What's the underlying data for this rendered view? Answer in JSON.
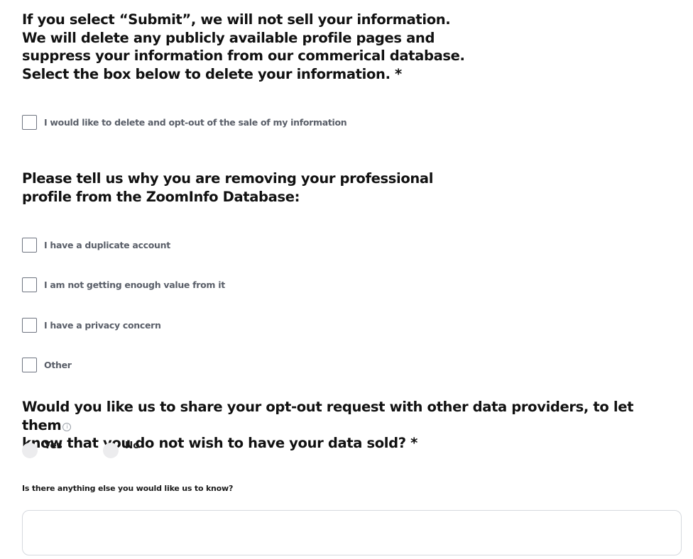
{
  "q1": {
    "title": "If you select “Submit”, we will not sell your information. We will delete any publicly available profile pages and suppress your information from our commerical database. Select the box below to delete your information. *"
  },
  "optout_checkbox": {
    "label": "I would like to delete and opt-out of the sale of my information",
    "checked": false
  },
  "q2": {
    "title": "Please tell us why you are removing your professional profile from the ZoomInfo Database:"
  },
  "reasons": [
    {
      "label": "I have a duplicate account",
      "checked": false
    },
    {
      "label": "I am not getting enough value from it",
      "checked": false
    },
    {
      "label": "I have a privacy concern",
      "checked": false
    },
    {
      "label": "Other",
      "checked": false
    }
  ],
  "q3": {
    "title_line1": "Would you like us to share your opt-out request with other data providers, to let them",
    "info_glyph": "i",
    "title_line2": "know that you do not wish to have your data sold? *",
    "options": [
      {
        "label": "Yes",
        "selected": false
      },
      {
        "label": "No",
        "selected": false
      }
    ]
  },
  "comments": {
    "label": "Is there anything else you would like us to know?",
    "value": ""
  },
  "colors": {
    "title": "#111111",
    "checkbox_label": "#5a5f69",
    "checkbox_border": "#6e7480",
    "radio_fill": "#ececee",
    "textarea_border": "#d6d9de"
  }
}
